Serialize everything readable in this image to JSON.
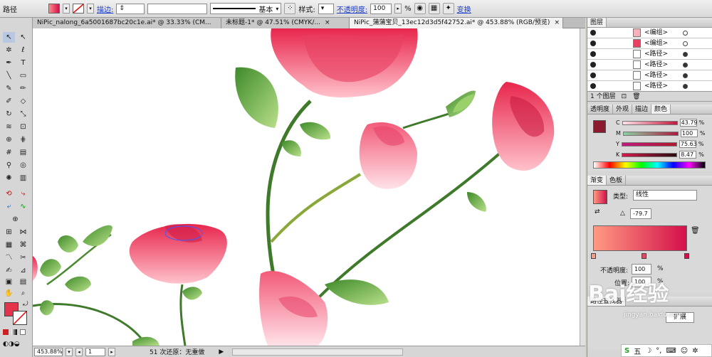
{
  "control_bar": {
    "object_label": "路径",
    "stroke_link": "描边:",
    "stroke_style": "基本",
    "style_label": "样式:",
    "opacity_link": "不透明度:",
    "opacity_value": "100",
    "percent": "%",
    "transform_link": "变换",
    "fill_color": "#e8364f"
  },
  "tabs": [
    {
      "label": "NiPic_nalong_6a5001687bc20c1e.ai* @ 33.33% (CM...",
      "close": "×"
    },
    {
      "label": "未标题-1* @ 47.51% (CMYK/...",
      "close": "×"
    },
    {
      "label": "NiPic_蒲蒲宝贝_13ec12d3d5f42752.ai* @ 453.88% (RGB/预览)",
      "close": "×"
    }
  ],
  "status": {
    "zoom": "453.88%",
    "page": "1",
    "undo": "51 次还原：无重做"
  },
  "layers_panel": {
    "title": "图层",
    "rows": [
      {
        "name": "<编组>"
      },
      {
        "name": "<编组>"
      },
      {
        "name": "<路径>"
      },
      {
        "name": "<路径>"
      },
      {
        "name": "<路径>"
      },
      {
        "name": "<路径>"
      }
    ],
    "footer": "1 个图层"
  },
  "color_panel": {
    "tabs": [
      "透明度",
      "外观",
      "描边",
      "颜色"
    ],
    "channels": [
      {
        "label": "C",
        "value": "43.79"
      },
      {
        "label": "M",
        "value": "100"
      },
      {
        "label": "Y",
        "value": "75.63"
      },
      {
        "label": "K",
        "value": "8.47"
      }
    ],
    "percent": "%",
    "swatch": "#8b1a2e"
  },
  "gradient_panel": {
    "tabs": [
      "渐变",
      "色板"
    ],
    "type_label": "类型:",
    "type_value": "线性",
    "angle": "-79.7",
    "start_color": "#ff9a82",
    "end_color": "#d4104a",
    "opacity_label": "不透明度:",
    "opacity_value": "100",
    "location_label": "位置:",
    "location_value": "100",
    "percent": "%"
  },
  "bottom_panel": {
    "title": "路径查找器",
    "expand": "扩展"
  },
  "watermark": {
    "main": "Bai经验",
    "sub": "jingyan.baidu.com"
  },
  "ime": {
    "label": "五"
  }
}
